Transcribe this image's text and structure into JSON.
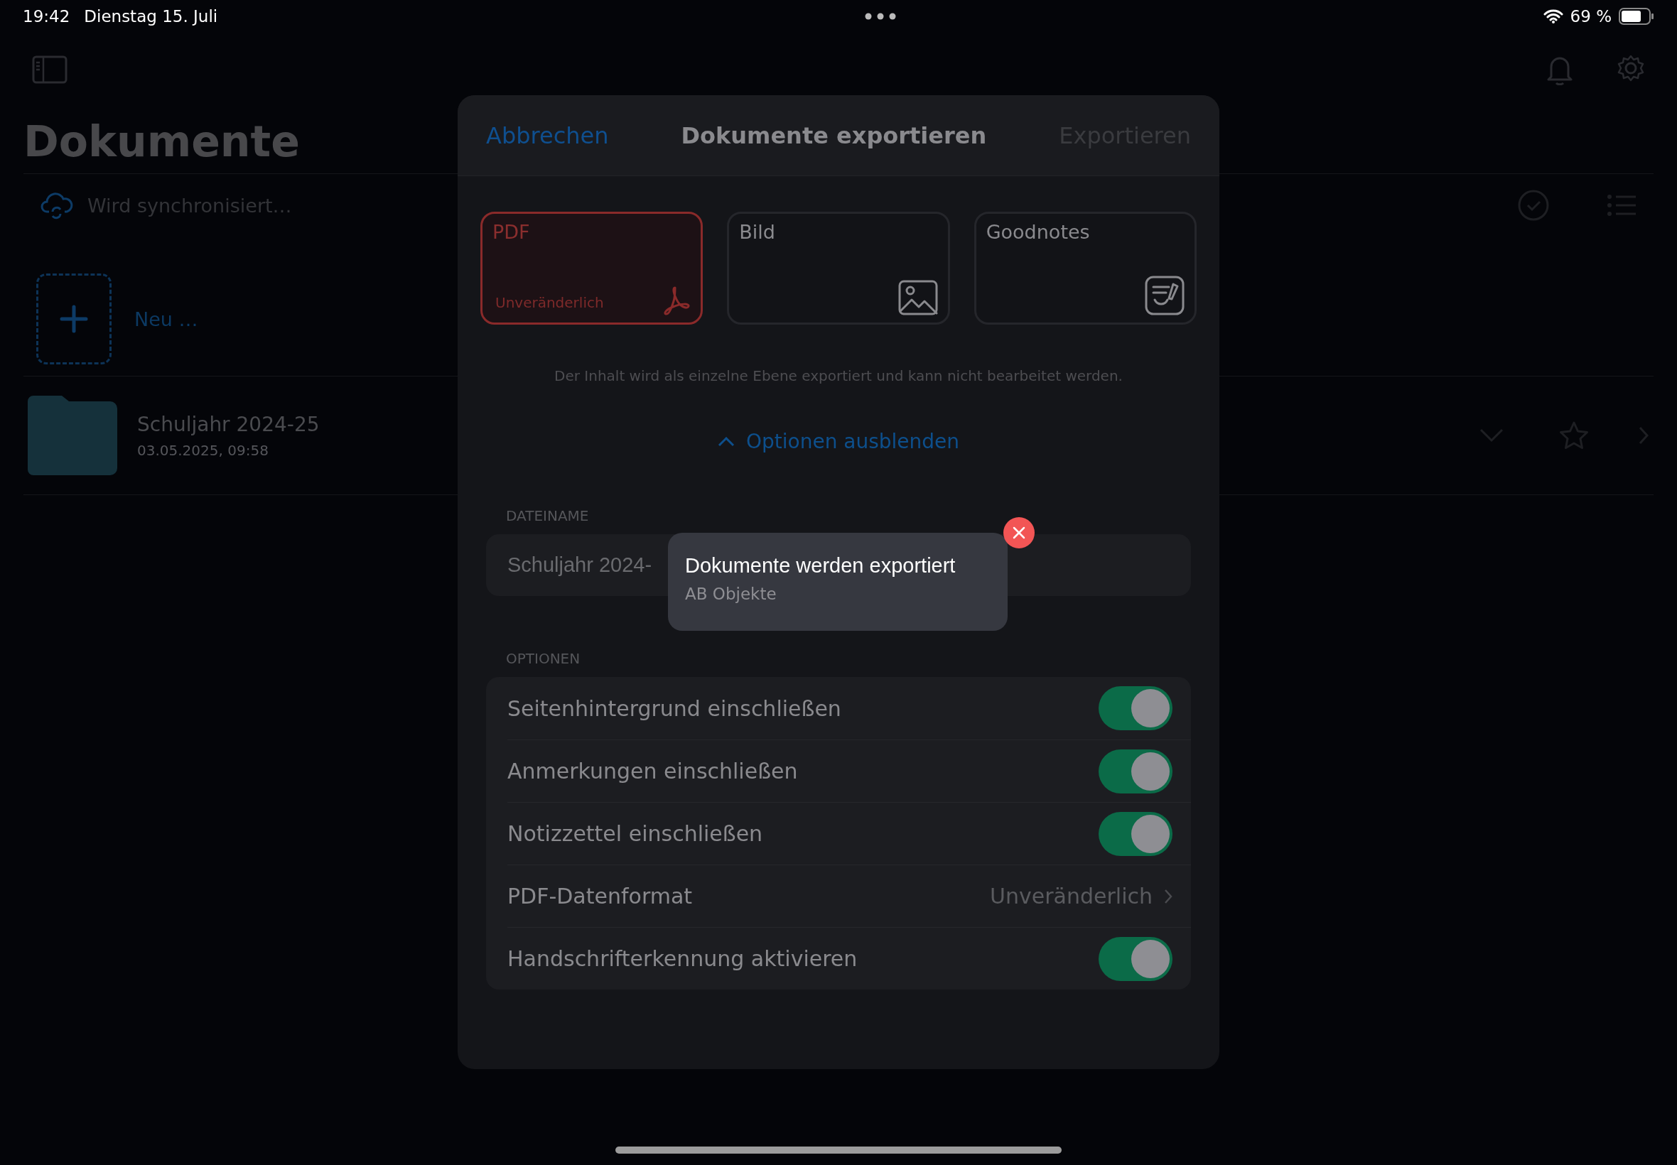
{
  "status_bar": {
    "time": "19:42",
    "date": "Dienstag 15. Juli",
    "battery": "69 %"
  },
  "header": {
    "title": "Dokumente"
  },
  "sync_status": "Wird synchronisiert…",
  "new_item": {
    "label": "Neu …"
  },
  "folders": [
    {
      "name": "Schuljahr 2024-25",
      "date": "03.05.2025, 09:58"
    }
  ],
  "dialog": {
    "cancel": "Abbrechen",
    "title": "Dokumente exportieren",
    "confirm": {
      "label": "Exportieren",
      "disabled": true
    },
    "formats": [
      {
        "kind": "pdf",
        "label": "PDF",
        "subtitle": "Unveränderlich",
        "selected": true
      },
      {
        "kind": "image",
        "label": "Bild",
        "selected": false
      },
      {
        "kind": "goodnotes",
        "label": "Goodnotes",
        "selected": false
      }
    ],
    "description": "Der Inhalt wird als einzelne Ebene exportiert und kann nicht bearbeitet werden.",
    "options_toggle": {
      "label": "Optionen ausblenden",
      "expanded": true
    },
    "filename_label": "DATEINAME",
    "filename": "Schuljahr 2024-",
    "options_label": "OPTIONEN",
    "options": [
      {
        "kind": "toggle",
        "label": "Seitenhintergrund einschließen",
        "on": true
      },
      {
        "kind": "toggle",
        "label": "Anmerkungen einschließen",
        "on": true
      },
      {
        "kind": "toggle",
        "label": "Notizzettel einschließen",
        "on": true
      },
      {
        "kind": "link",
        "label": "PDF-Datenformat",
        "value": "Unveränderlich"
      },
      {
        "kind": "toggle",
        "label": "Handschrifterkennung aktivieren",
        "on": true
      }
    ]
  },
  "toast": {
    "title": "Dokumente werden exportiert",
    "subtitle": "AB Objekte"
  }
}
